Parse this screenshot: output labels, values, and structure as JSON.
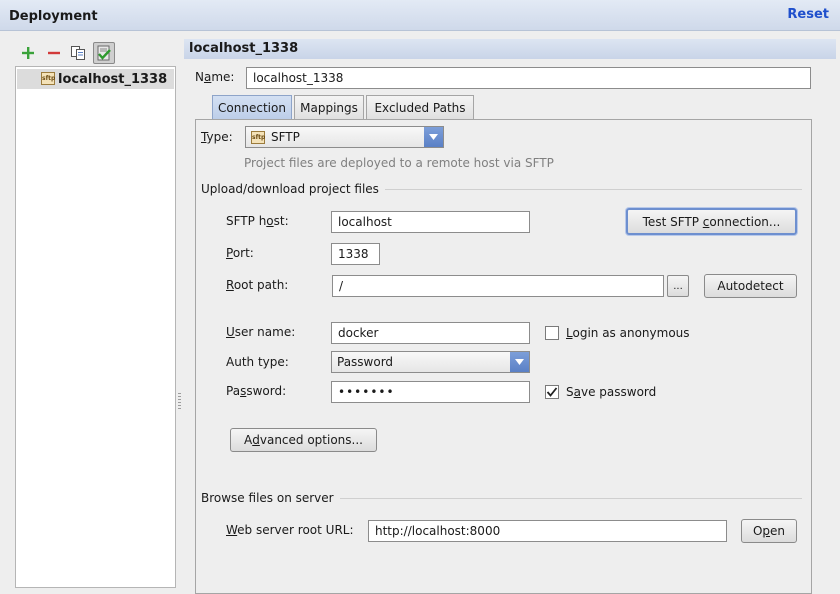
{
  "dialog": {
    "title": "Deployment",
    "reset_label": "Reset"
  },
  "icons": {
    "add": "plus-icon",
    "remove": "minus-icon",
    "copy": "copy-icon",
    "default": "default-server-check-icon",
    "sftp": "sftp-icon",
    "dropdown": "chevron-down-icon"
  },
  "colors": {
    "add": "#3aa23a",
    "remove": "#d23a3a",
    "link": "#1f4fcc",
    "accent": "#5a80c6"
  },
  "sidebar": {
    "items": [
      {
        "label": "localhost_1338",
        "icon_text": "sftp"
      }
    ]
  },
  "server": {
    "header": "localhost_1338",
    "name_label": "Name:",
    "name_value": "localhost_1338"
  },
  "tabs": [
    {
      "label": "Connection",
      "active": true
    },
    {
      "label": "Mappings",
      "active": false
    },
    {
      "label": "Excluded Paths",
      "active": false
    }
  ],
  "connection": {
    "type_label": "Type:",
    "type_value": "SFTP",
    "type_description": "Project files are deployed to a remote host via SFTP",
    "upload_section": "Upload/download project files",
    "host_label": "SFTP host:",
    "host_value": "localhost",
    "test_button": "Test SFTP connection...",
    "port_label": "Port:",
    "port_value": "1338",
    "root_label": "Root path:",
    "root_value": "/",
    "browse_button": "...",
    "autodetect_button": "Autodetect",
    "user_label": "User name:",
    "user_value": "docker",
    "anonymous_label": "Login as anonymous",
    "anonymous_checked": false,
    "auth_label": "Auth type:",
    "auth_value": "Password",
    "password_label": "Password:",
    "password_value": "•••••••",
    "save_password_label": "Save password",
    "save_password_checked": true,
    "advanced_button": "Advanced options...",
    "browse_section": "Browse files on server",
    "web_root_label": "Web server root URL:",
    "web_root_value": "http://localhost:8000",
    "open_button": "Open"
  }
}
